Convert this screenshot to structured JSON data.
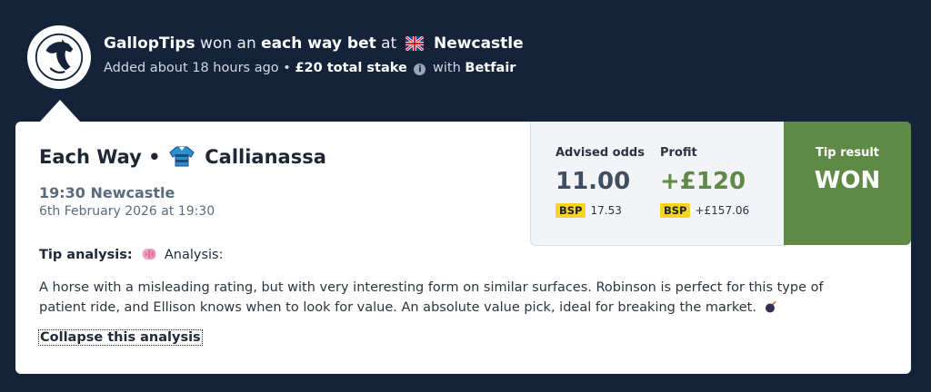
{
  "header": {
    "tipster_name": "GallopTips",
    "won_text": "won an",
    "bet_type": "each way bet",
    "at_text": "at",
    "course": "Newcastle",
    "added_text": "Added about 18 hours ago",
    "separator": "•",
    "stake": "£20 total stake",
    "with_text": "with",
    "bookmaker": "Betfair",
    "flag_icon": "uk-flag-icon",
    "info_icon": "info-icon"
  },
  "card": {
    "bet_label": "Each Way",
    "separator": "•",
    "horse_name": "Callianassa",
    "race_time": "19:30 Newcastle",
    "race_date": "6th February 2026 at 19:30",
    "advised_odds_label": "Advised odds",
    "advised_odds": "11.00",
    "odds_bsp_badge": "BSP",
    "odds_bsp_value": "17.53",
    "profit_label": "Profit",
    "profit": "+£120",
    "profit_bsp_badge": "BSP",
    "profit_bsp_value": "+£157.06",
    "result_label": "Tip result",
    "result_value": "WON",
    "analysis_label": "Tip analysis:",
    "analysis_sub": "Analysis:",
    "analysis_text": "A horse with a misleading rating, but with very interesting form on similar surfaces. Robinson is perfect for this type of patient ride, and Ellison knows when to look for value. An absolute value pick, ideal for breaking the market.",
    "collapse_label": "Collapse this analysis"
  },
  "colors": {
    "background": "#14233a",
    "profit_green": "#5f8a45",
    "result_green": "#5f8a45",
    "bsp_yellow": "#f6d41f",
    "odds_text": "#3f4f61"
  }
}
